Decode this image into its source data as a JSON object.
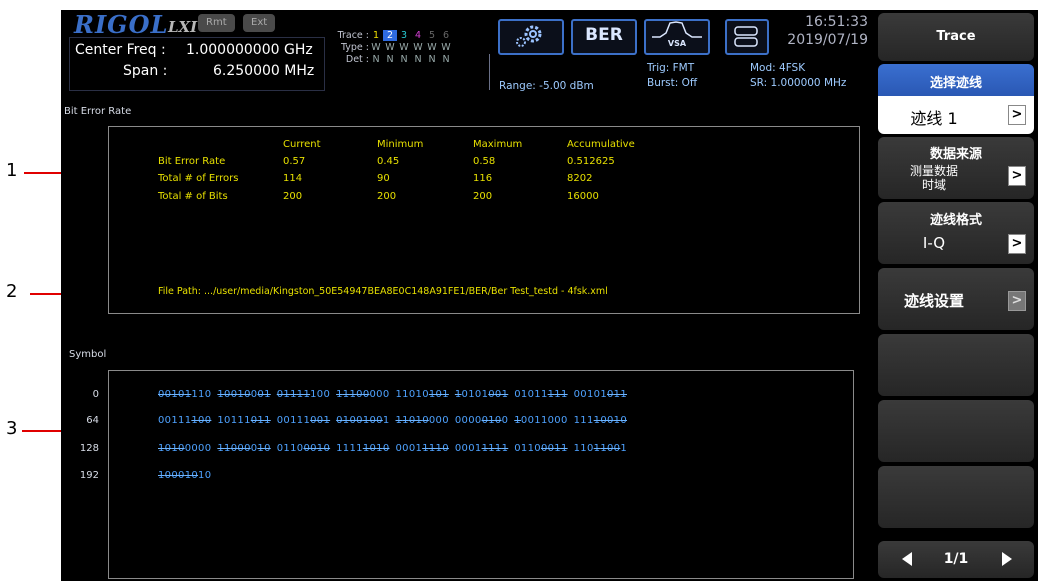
{
  "callouts": [
    "1",
    "2",
    "3"
  ],
  "header": {
    "logo": "RIGOL",
    "lxi": "LXI",
    "rmt": "Rmt",
    "ext": "Ext",
    "center_freq_label": "Center Freq :",
    "center_freq_value": "1.000000000 GHz",
    "span_label": "Span :",
    "span_value": "6.250000 MHz",
    "trace_label": "Trace :",
    "type_label": "Type :",
    "det_label": "Det :",
    "trace_numbers": [
      "1",
      "2",
      "3",
      "4",
      "5",
      "6"
    ],
    "type_values": [
      "W",
      "W",
      "W",
      "W",
      "W",
      "W"
    ],
    "det_values": [
      "N",
      "N",
      "N",
      "N",
      "N",
      "N"
    ],
    "range": "Range: -5.00 dBm",
    "trig": "Trig: FMT",
    "burst": "Burst: Off",
    "mod": "Mod: 4FSK",
    "sr": "SR: 1.000000 MHz",
    "mode_ber": "BER",
    "mode_vsa": "VSA",
    "time": "16:51:33",
    "date": "2019/07/19"
  },
  "ber": {
    "section_title": "Bit Error Rate",
    "columns": [
      "Current",
      "Minimum",
      "Maximum",
      "Accumulative"
    ],
    "rows": [
      {
        "label": "Bit Error Rate",
        "values": [
          "0.57",
          "0.45",
          "0.58",
          "0.512625"
        ]
      },
      {
        "label": "Total # of Errors",
        "values": [
          "114",
          "90",
          "116",
          "8202"
        ]
      },
      {
        "label": "Total # of Bits",
        "values": [
          "200",
          "200",
          "200",
          "16000"
        ]
      }
    ],
    "file_path": "File Path: .../user/media/Kingston_50E54947BEA8E0C148A91FE1/BER/Ber Test_testd - 4fsk.xml"
  },
  "symbol": {
    "section_title": "Symbol",
    "indices": [
      "0",
      "64",
      "128",
      "192"
    ],
    "rows": [
      [
        "00101110",
        "10010001",
        "01111100",
        "11100000",
        "11010101",
        "10101001",
        "01011111",
        "00101011"
      ],
      [
        "00111100",
        "10111011",
        "00111001",
        "01001001",
        "11010000",
        "00000100",
        "10011000",
        "11110010"
      ],
      [
        "10100000",
        "11000010",
        "01100010",
        "11111010",
        "00011110",
        "00011111",
        "01100011",
        "11011001"
      ],
      [
        "10001010"
      ]
    ],
    "struck": [
      [
        "sssss...",
        "sssss.ss",
        "sssss...",
        "sssss...",
        ".....sss",
        "s....sss",
        ".....sss",
        ".....sss"
      ],
      [
        ".....sss",
        ".....sss",
        ".....sss",
        "sssssss.",
        "sssss...",
        "....sss.",
        "s.......",
        "...sssss"
      ],
      [
        "ssss....",
        "sssss.ss",
        "....ssss",
        "....ssss",
        "....ssss",
        "....ssss",
        "....ssss",
        "...ssss."
      ],
      [
        "ssssss.."
      ]
    ]
  },
  "menu": {
    "title": "Trace",
    "items": [
      {
        "label": "选择迹线",
        "value": "迹线 1"
      },
      {
        "label": "数据来源",
        "value_line1": "测量数据",
        "value_line2": "时域"
      },
      {
        "label": "迹线格式",
        "value": "I-Q"
      },
      {
        "label": "迹线设置"
      }
    ],
    "page": "1/1"
  }
}
